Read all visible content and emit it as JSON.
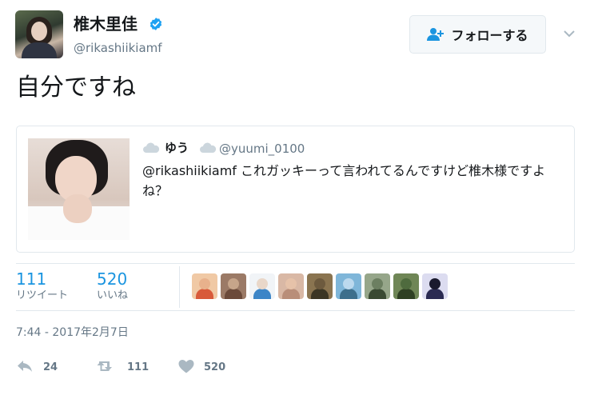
{
  "user": {
    "name": "椎木里佳",
    "handle": "@rikashiikiamf",
    "verified": true
  },
  "follow_button": {
    "label": "フォローする"
  },
  "tweet": {
    "text": "自分ですね"
  },
  "quoted_tweet": {
    "name": "ゆう",
    "handle": "@yuumi_0100",
    "text": "@rikashiikiamf これガッキーって言われてるんですけど椎木様ですよね？"
  },
  "stats": {
    "retweets": {
      "count": "111",
      "label": "リツイート"
    },
    "likes": {
      "count": "520",
      "label": "いいね"
    }
  },
  "likers": [
    {
      "head": "#e8b18c",
      "torso": "#d85a3a",
      "bg": "#f0c9a5"
    },
    {
      "head": "#c6a58a",
      "torso": "#6b4a3a",
      "bg": "#9b7a66"
    },
    {
      "head": "#e9d7c9",
      "torso": "#3c85c7",
      "bg": "#f1f4f7"
    },
    {
      "head": "#e6c2a9",
      "torso": "#b98e79",
      "bg": "#d9b8a5"
    },
    {
      "head": "#6d5a3e",
      "torso": "#3c3624",
      "bg": "#8a7450"
    },
    {
      "head": "#bcd9ee",
      "torso": "#3d6f8c",
      "bg": "#7fb6d9"
    },
    {
      "head": "#6c7f61",
      "torso": "#3a4a33",
      "bg": "#96a68a"
    },
    {
      "head": "#4f6b3e",
      "torso": "#2f4023",
      "bg": "#6f8656"
    },
    {
      "head": "#1a1a2e",
      "torso": "#2b2b52",
      "bg": "#dcdcf0"
    }
  ],
  "timestamp": "7:44 - 2017年2月7日",
  "actions": {
    "reply_count": "24",
    "retweet_count": "111",
    "like_count": "520"
  },
  "colors": {
    "accent": "#1b95e0",
    "verified": "#1da1f2",
    "muted": "#657786",
    "border": "#e1e8ed"
  }
}
